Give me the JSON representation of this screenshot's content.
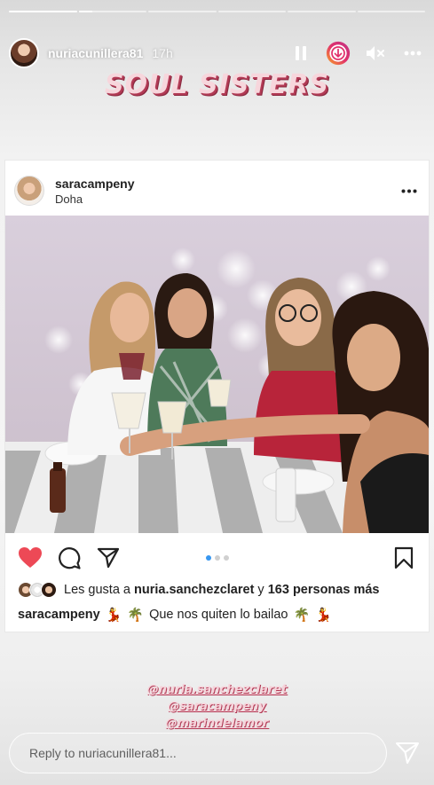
{
  "progress": {
    "segments": [
      1,
      0.2,
      0,
      0,
      0,
      0
    ]
  },
  "header": {
    "username": "nuriacunillera81",
    "time": "17h"
  },
  "story": {
    "title": "SOUL SISTERS"
  },
  "post": {
    "username": "saracampeny",
    "location": "Doha",
    "likes_prefix": "Les gusta a ",
    "likes_user": "nuria.sanchezclaret",
    "likes_middle": " y ",
    "likes_count": "163 personas más",
    "caption_user": "saracampeny",
    "caption_text": "Que nos quiten lo bailao",
    "carousel_index": 1,
    "carousel_total": 3
  },
  "mentions": [
    "@nuria.sanchezclaret",
    "@saracampeny",
    "@marindelamor"
  ],
  "reply": {
    "placeholder": "Reply to nuriacunillera81..."
  },
  "colors": {
    "like": "#ed4956",
    "accent_pink": "#b23a55",
    "carousel_active": "#3897f0"
  },
  "icons": [
    "pause-icon",
    "download-icon",
    "mute-icon",
    "more-icon",
    "heart-icon",
    "comment-icon",
    "share-icon",
    "bookmark-icon",
    "send-icon"
  ]
}
